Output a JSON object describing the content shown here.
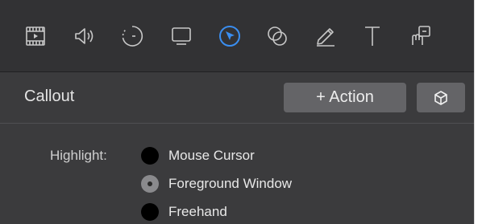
{
  "toolbar": {
    "items": [
      {
        "icon": "media-icon"
      },
      {
        "icon": "speaker-icon"
      },
      {
        "icon": "timer-icon"
      },
      {
        "icon": "display-icon"
      },
      {
        "icon": "cursor-icon",
        "active": true
      },
      {
        "icon": "overlap-circles-icon"
      },
      {
        "icon": "pencil-icon"
      },
      {
        "icon": "text-icon"
      },
      {
        "icon": "gesture-icon"
      }
    ],
    "active_color": "#3a8ef0",
    "icon_color": "#c8c8c8"
  },
  "header": {
    "title": "Callout",
    "action_label": "+ Action",
    "cube_icon": "cube-icon"
  },
  "highlight": {
    "label": "Highlight:",
    "options": [
      {
        "label": "Mouse Cursor",
        "selected": false
      },
      {
        "label": "Foreground Window",
        "selected": true
      },
      {
        "label": "Freehand",
        "selected": false
      }
    ]
  }
}
